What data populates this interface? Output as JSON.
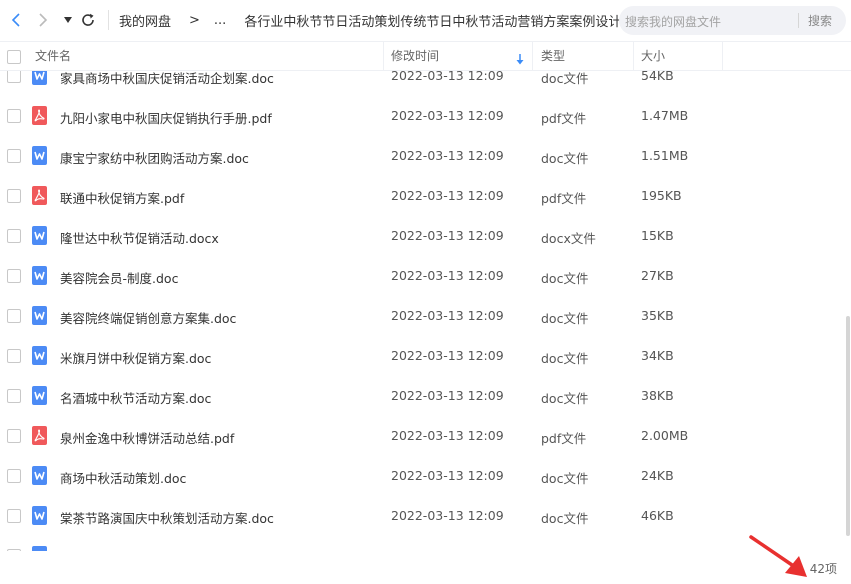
{
  "toolbar": {
    "breadcrumb_root": "我的网盘",
    "breadcrumb_sep": ">",
    "breadcrumb_ellipsis": "...",
    "breadcrumb_current": "各行业中秋节节日活动策划传统节日中秋节活动营销方案案例设计",
    "search_placeholder": "搜索我的网盘文件",
    "search_button": "搜索"
  },
  "columns": {
    "name": "文件名",
    "modified": "修改时间",
    "type": "类型",
    "size": "大小"
  },
  "files": [
    {
      "name": "家具商场中秋国庆促销活动企划案.doc",
      "date": "2022-03-13 12:09",
      "type": "doc文件",
      "size": "54KB",
      "kind": "word"
    },
    {
      "name": "九阳小家电中秋国庆促销执行手册.pdf",
      "date": "2022-03-13 12:09",
      "type": "pdf文件",
      "size": "1.47MB",
      "kind": "pdf"
    },
    {
      "name": "康宝宁家纺中秋团购活动方案.doc",
      "date": "2022-03-13 12:09",
      "type": "doc文件",
      "size": "1.51MB",
      "kind": "word"
    },
    {
      "name": "联通中秋促销方案.pdf",
      "date": "2022-03-13 12:09",
      "type": "pdf文件",
      "size": "195KB",
      "kind": "pdf"
    },
    {
      "name": "隆世达中秋节促销活动.docx",
      "date": "2022-03-13 12:09",
      "type": "docx文件",
      "size": "15KB",
      "kind": "word"
    },
    {
      "name": "美容院会员-制度.doc",
      "date": "2022-03-13 12:09",
      "type": "doc文件",
      "size": "27KB",
      "kind": "word"
    },
    {
      "name": "美容院终端促销创意方案集.doc",
      "date": "2022-03-13 12:09",
      "type": "doc文件",
      "size": "35KB",
      "kind": "word"
    },
    {
      "name": "米旗月饼中秋促销方案.doc",
      "date": "2022-03-13 12:09",
      "type": "doc文件",
      "size": "34KB",
      "kind": "word"
    },
    {
      "name": "名酒城中秋节活动方案.doc",
      "date": "2022-03-13 12:09",
      "type": "doc文件",
      "size": "38KB",
      "kind": "word"
    },
    {
      "name": "泉州金逸中秋博饼活动总结.pdf",
      "date": "2022-03-13 12:09",
      "type": "pdf文件",
      "size": "2.00MB",
      "kind": "pdf"
    },
    {
      "name": "商场中秋活动策划.doc",
      "date": "2022-03-13 12:09",
      "type": "doc文件",
      "size": "24KB",
      "kind": "word"
    },
    {
      "name": "棠茶节路演国庆中秋策划活动方案.doc",
      "date": "2022-03-13 12:09",
      "type": "doc文件",
      "size": "46KB",
      "kind": "word"
    },
    {
      "name": "",
      "date": "",
      "type": "",
      "size": "",
      "kind": "word"
    }
  ],
  "footer": {
    "count": "42项"
  },
  "colors": {
    "word": "#4c8bf5",
    "pdf": "#f0595b",
    "annotation_arrow": "#e8302f",
    "sort_arrow": "#3b8cf7"
  }
}
